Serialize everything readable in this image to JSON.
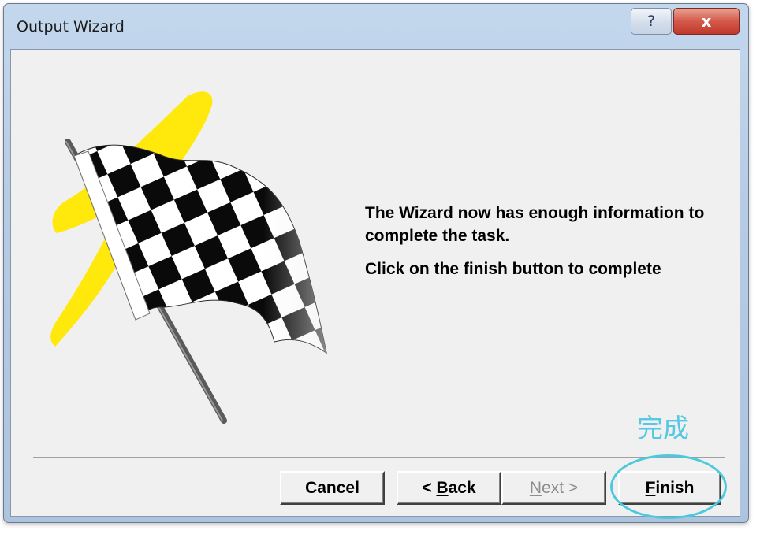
{
  "window": {
    "title": "Output Wizard",
    "help_glyph": "?",
    "close_glyph": "x"
  },
  "message": {
    "line1": "The Wizard now has enough information to complete the task.",
    "line2": "Click on the finish button to complete"
  },
  "annotation": {
    "text": "完成",
    "color": "#55c8e3"
  },
  "buttons": {
    "cancel": "Cancel",
    "back_prefix": "< ",
    "back_accel": "B",
    "back_rest": "ack",
    "next_accel": "N",
    "next_rest": "ext >",
    "finish_accel": "F",
    "finish_rest": "inish"
  },
  "icons": {
    "illustration": "checkered-flag-icon"
  },
  "colors": {
    "title_bar": "#b6cbe4",
    "close_button": "#c0392b",
    "dialog_face": "#f0f0f0",
    "highlight_stroke": "#ffe800"
  }
}
